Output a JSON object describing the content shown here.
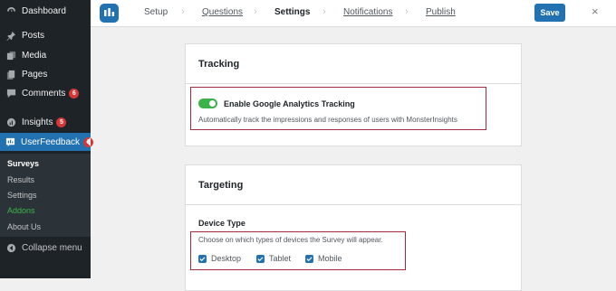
{
  "sidebar": {
    "items": [
      {
        "label": "Dashboard",
        "icon": "dashboard-icon"
      },
      {
        "label": "Posts",
        "icon": "pin-icon"
      },
      {
        "label": "Media",
        "icon": "media-icon"
      },
      {
        "label": "Pages",
        "icon": "pages-icon"
      },
      {
        "label": "Comments",
        "icon": "comment-icon",
        "badge": "6"
      },
      {
        "label": "Insights",
        "icon": "insights-icon",
        "badge": "5"
      },
      {
        "label": "UserFeedback",
        "icon": "userfeedback-icon",
        "badge": "1"
      }
    ],
    "submenu": [
      "Surveys",
      "Results",
      "Settings",
      "Addons",
      "About Us"
    ],
    "collapse_label": "Collapse menu"
  },
  "topbar": {
    "steps": [
      "Setup",
      "Questions",
      "Settings",
      "Notifications",
      "Publish"
    ],
    "active_step": "Settings",
    "save_label": "Save",
    "close_symbol": "×"
  },
  "tracking": {
    "title": "Tracking",
    "toggle_label": "Enable Google Analytics Tracking",
    "toggle_on": true,
    "description": "Automatically track the impressions and responses of users with MonsterInsights"
  },
  "targeting": {
    "title": "Targeting",
    "device_type_label": "Device Type",
    "device_type_description": "Choose on which types of devices the Survey will appear.",
    "devices": [
      {
        "label": "Desktop",
        "checked": true
      },
      {
        "label": "Tablet",
        "checked": true
      },
      {
        "label": "Mobile",
        "checked": true
      }
    ]
  },
  "colors": {
    "sidebar_bg": "#1d2327",
    "accent": "#2271b1",
    "toggle_on": "#3bb34a",
    "badge": "#d63638",
    "highlight_border": "#a52a3f",
    "addons_green": "#3bb34a"
  }
}
